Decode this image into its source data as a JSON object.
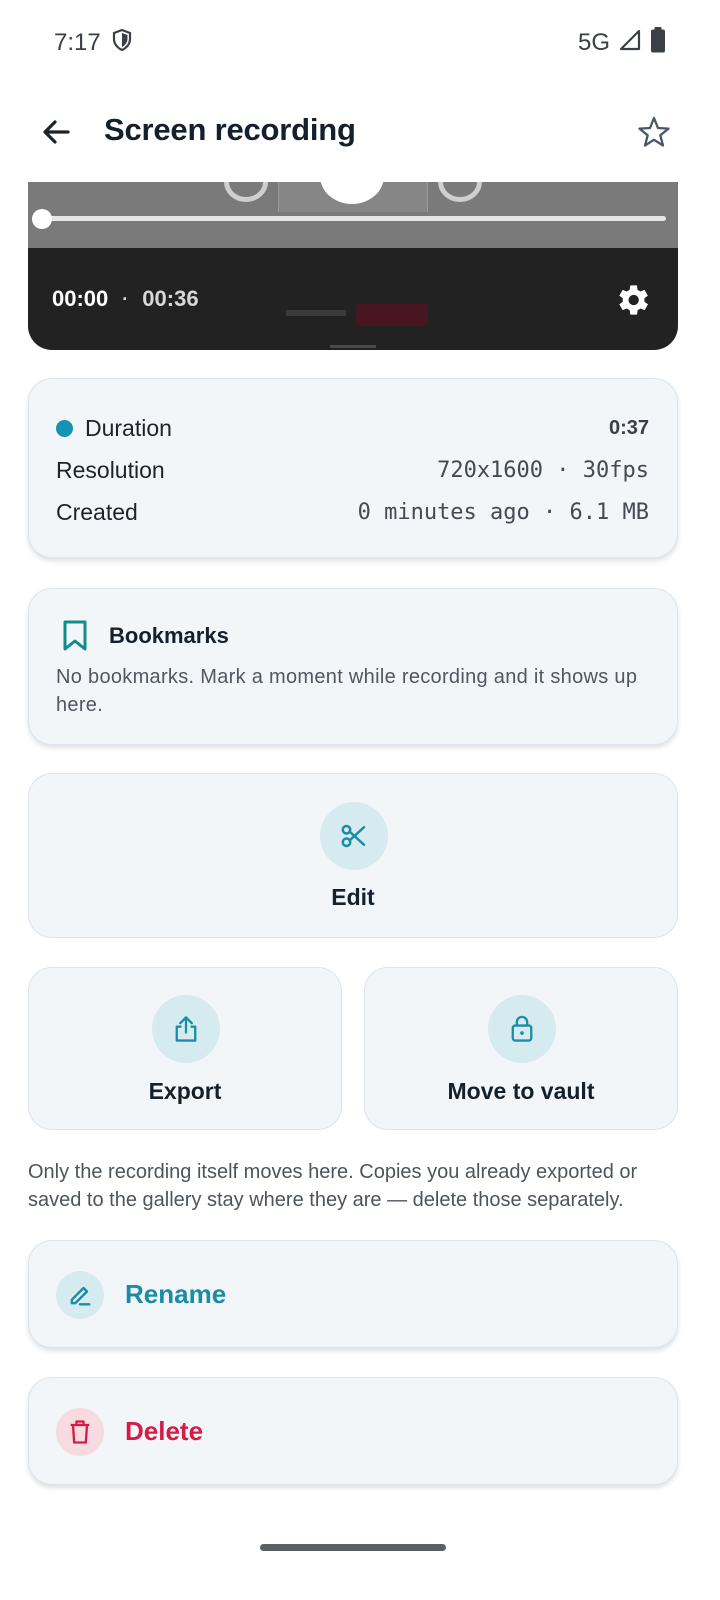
{
  "status_bar": {
    "time": "7:17",
    "network": "5G",
    "icons": [
      "shield-icon",
      "signal-icon",
      "battery-icon"
    ]
  },
  "app_bar": {
    "title": "Screen recording",
    "back_icon": "arrow-back-icon",
    "favorite_icon": "star-outline-icon"
  },
  "player": {
    "current_time": "00:00",
    "separator": "·",
    "total_time": "00:36",
    "progress": 0.0,
    "settings_icon": "gear-icon"
  },
  "info": {
    "duration_label": "Duration",
    "duration_value": "0:37",
    "resolution_label": "Resolution",
    "resolution_value": "720x1600 · 30fps",
    "created_label": "Created",
    "created_value": "0 minutes ago · 6.1 MB"
  },
  "bookmarks": {
    "title": "Bookmarks",
    "empty_text": "No bookmarks. Mark a moment while recording and it shows up here.",
    "icon": "bookmark-icon"
  },
  "actions": {
    "edit": {
      "label": "Edit",
      "icon": "scissors-icon"
    },
    "export": {
      "label": "Export",
      "icon": "share-icon"
    },
    "vault": {
      "label": "Move to vault",
      "icon": "lock-icon"
    }
  },
  "vault_note": "Only the recording itself moves here. Copies you already exported or saved to the gallery stay where they are — delete those separately.",
  "rename": {
    "label": "Rename",
    "icon": "pencil-icon"
  },
  "delete": {
    "label": "Delete",
    "icon": "trash-icon"
  },
  "colors": {
    "accent": "#1593b4",
    "rename_text": "#1a8ca6",
    "delete_text": "#d41c48",
    "card_bg": "#f2f6f9",
    "icon_circle": "#d6ebef",
    "delete_circle": "#f7dbe1"
  }
}
